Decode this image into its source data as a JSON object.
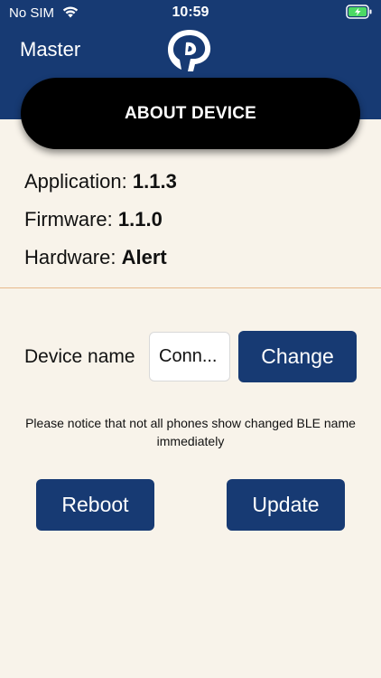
{
  "status_bar": {
    "carrier": "No SIM",
    "time": "10:59",
    "wifi_icon": "wifi-icon",
    "battery_icon": "battery-charging-icon"
  },
  "nav": {
    "back_label": "Master",
    "logo_icon": "brand-logo"
  },
  "title": "ABOUT DEVICE",
  "info": {
    "application_label": "Application:",
    "application_value": "1.1.3",
    "firmware_label": "Firmware:",
    "firmware_value": "1.1.0",
    "hardware_label": "Hardware:",
    "hardware_value": "Alert"
  },
  "device_name": {
    "label": "Device name",
    "value": "Conn...",
    "change_label": "Change"
  },
  "notice": "Please notice that not all phones show changed BLE name immediately",
  "actions": {
    "reboot_label": "Reboot",
    "update_label": "Update"
  },
  "colors": {
    "header": "#173a73",
    "background": "#f8f3ea",
    "button": "#173a73",
    "title_pill": "#000000",
    "battery": "#4cd964"
  }
}
